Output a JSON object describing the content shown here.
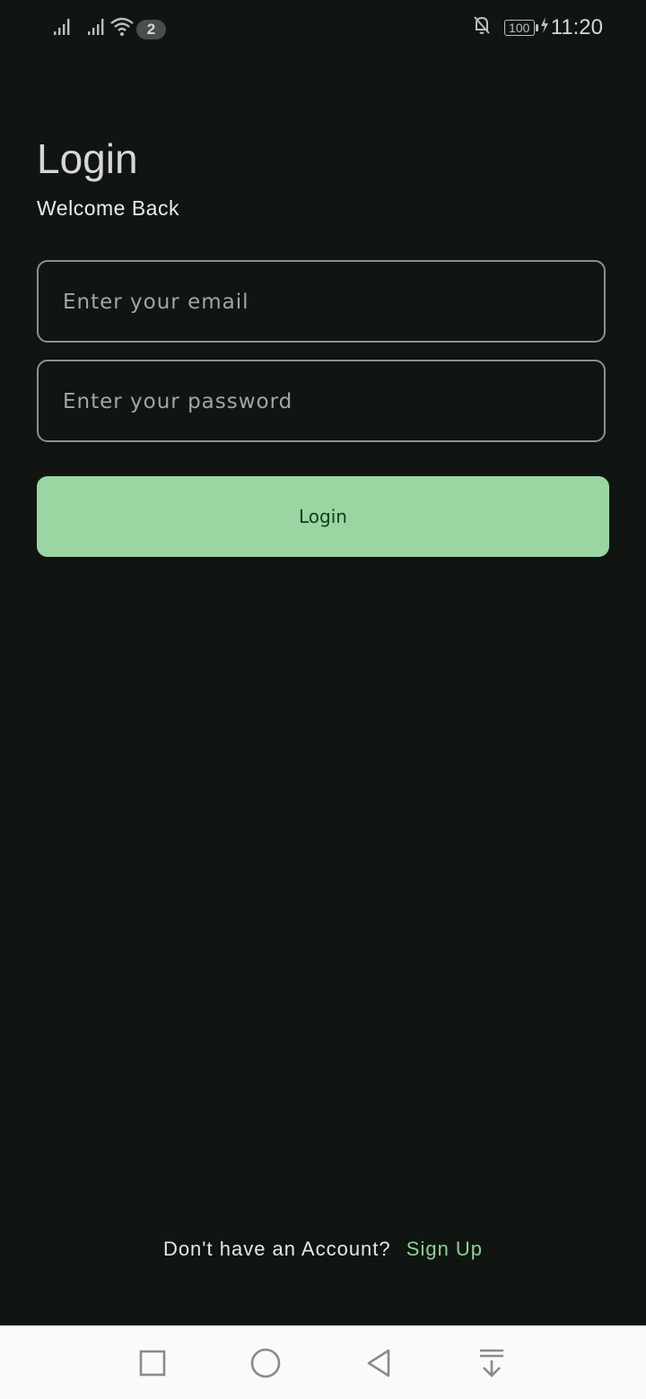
{
  "status_bar": {
    "icons_left": [
      "signal-icon",
      "signal-icon",
      "wifi-icon"
    ],
    "wifi_badge": "2",
    "icons_right": [
      "bell-off-icon",
      "battery-icon",
      "charging-icon"
    ],
    "battery": "100",
    "time": "11:20"
  },
  "header": {
    "title": "Login",
    "subtitle": "Welcome Back"
  },
  "form": {
    "email_placeholder": "Enter your email",
    "email_value": "",
    "password_placeholder": "Enter your password",
    "password_value": "",
    "login_label": "Login"
  },
  "footer": {
    "prompt": "Don't have an Account?",
    "signup_label": "Sign Up"
  },
  "nav_bar": {
    "buttons": [
      "recents-square-icon",
      "home-circle-icon",
      "back-triangle-icon",
      "notification-pulldown-icon"
    ]
  },
  "colors": {
    "background": "#111512",
    "accent": "#9ad5a2",
    "link": "#8fcf94",
    "nav_background": "#fafafa"
  }
}
